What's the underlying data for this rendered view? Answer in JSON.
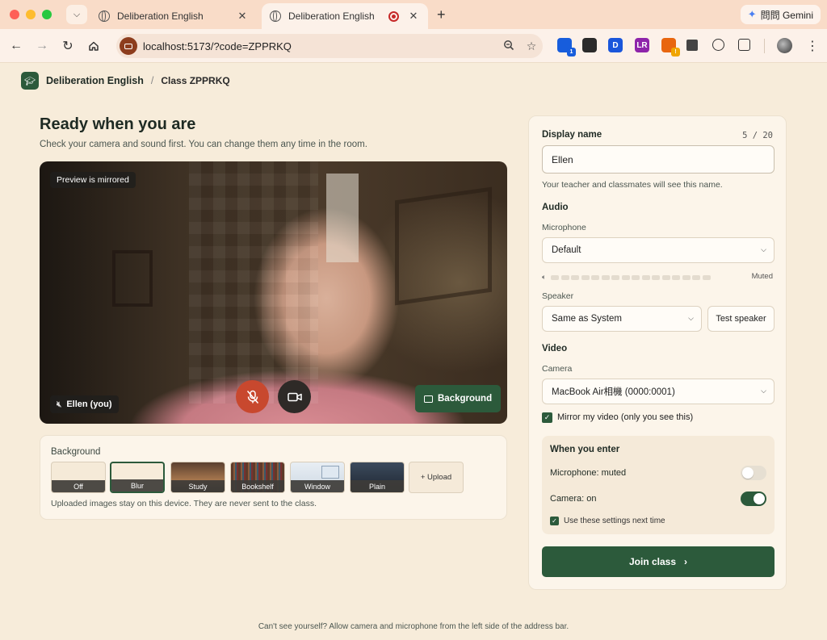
{
  "browser": {
    "tabs": [
      {
        "title": "Deliberation English",
        "active": false
      },
      {
        "title": "Deliberation English",
        "active": true,
        "recording": true
      }
    ],
    "new_tab": "+",
    "gemini_label": "問問 Gemini",
    "url": "localhost:5173/?code=ZPPRKQ",
    "extensions": [
      {
        "name": "ext-bitwarden",
        "glyph": "",
        "color": "#175ddc",
        "badge": "1",
        "badge_color": "#175ddc"
      },
      {
        "name": "ext-download",
        "glyph": "",
        "color": "#2b2b2b"
      },
      {
        "name": "ext-d",
        "glyph": "D",
        "color": "#1a56db"
      },
      {
        "name": "ext-lr",
        "glyph": "LR",
        "color": "#8e24aa"
      },
      {
        "name": "ext-burst",
        "glyph": "",
        "color": "#e8660f",
        "badge": "!",
        "badge_color": "#f0a500"
      },
      {
        "name": "ext-bar",
        "glyph": "",
        "color": "#444"
      },
      {
        "name": "ext-openai",
        "glyph": "",
        "color": "#fcf1e9"
      },
      {
        "name": "ext-puzzle",
        "glyph": "",
        "color": "#fcf1e9"
      }
    ]
  },
  "app": {
    "brand": "Deliberation English",
    "breadcrumb_sep": "/",
    "class_label": "Class ZPPRKQ"
  },
  "page": {
    "title": "Ready when you are",
    "subtitle": "Check your camera and sound first. You can change them any time in the room."
  },
  "preview": {
    "mirrored_label": "Preview is mirrored",
    "self_name": "Ellen (you)",
    "background_button": "Background"
  },
  "background": {
    "title": "Background",
    "options": [
      {
        "label": "Off",
        "selected": false,
        "fill": "#f5ead8"
      },
      {
        "label": "Blur",
        "selected": true,
        "fill": "#f7ecda"
      },
      {
        "label": "Study",
        "selected": false,
        "fill": "linear-gradient(180deg,#5b4030,#a8784e 60%,#3a2a1f)"
      },
      {
        "label": "Bookshelf",
        "selected": false,
        "fill": "repeating-linear-gradient(90deg,#5e3b2a 0 3px,#8a5a3c 3px 5px,#3a5a6a 5px 7px,#7a3030 7px 9px)"
      },
      {
        "label": "Window",
        "selected": false,
        "fill": "linear-gradient(180deg,#e8eef4,#cdd8e2)"
      },
      {
        "label": "Plain",
        "selected": false,
        "fill": "linear-gradient(180deg,#3c4a5c,#1e2632)"
      }
    ],
    "upload_label": "+ Upload",
    "note": "Uploaded images stay on this device. They are never sent to the class."
  },
  "settings": {
    "display_name_label": "Display name",
    "char_count": "5 / 20",
    "display_name_value": "Ellen",
    "display_name_help": "Your teacher and classmates will see this name.",
    "audio_label": "Audio",
    "microphone_label": "Microphone",
    "microphone_value": "Default",
    "mic_level": 0,
    "muted_label": "Muted",
    "speaker_label": "Speaker",
    "speaker_value": "Same as System",
    "test_speaker": "Test speaker",
    "video_label": "Video",
    "camera_label": "Camera",
    "camera_value": "MacBook Air相機 (0000:0001)",
    "mirror_label": "Mirror my video (only you see this)",
    "mirror_checked": true,
    "enter_title": "When you enter",
    "enter_mic": "Microphone: muted",
    "enter_mic_on": false,
    "enter_camera": "Camera: on",
    "enter_camera_on": true,
    "remember_label": "Use these settings next time",
    "remember_checked": true,
    "join_label": "Join class"
  },
  "footer": {
    "hint": "Can't see yourself? Allow camera and microphone from the left side of the address bar."
  },
  "colors": {
    "accent": "#2c5a3b",
    "mic_off": "#c8482e",
    "page_bg": "#f7ecda"
  }
}
